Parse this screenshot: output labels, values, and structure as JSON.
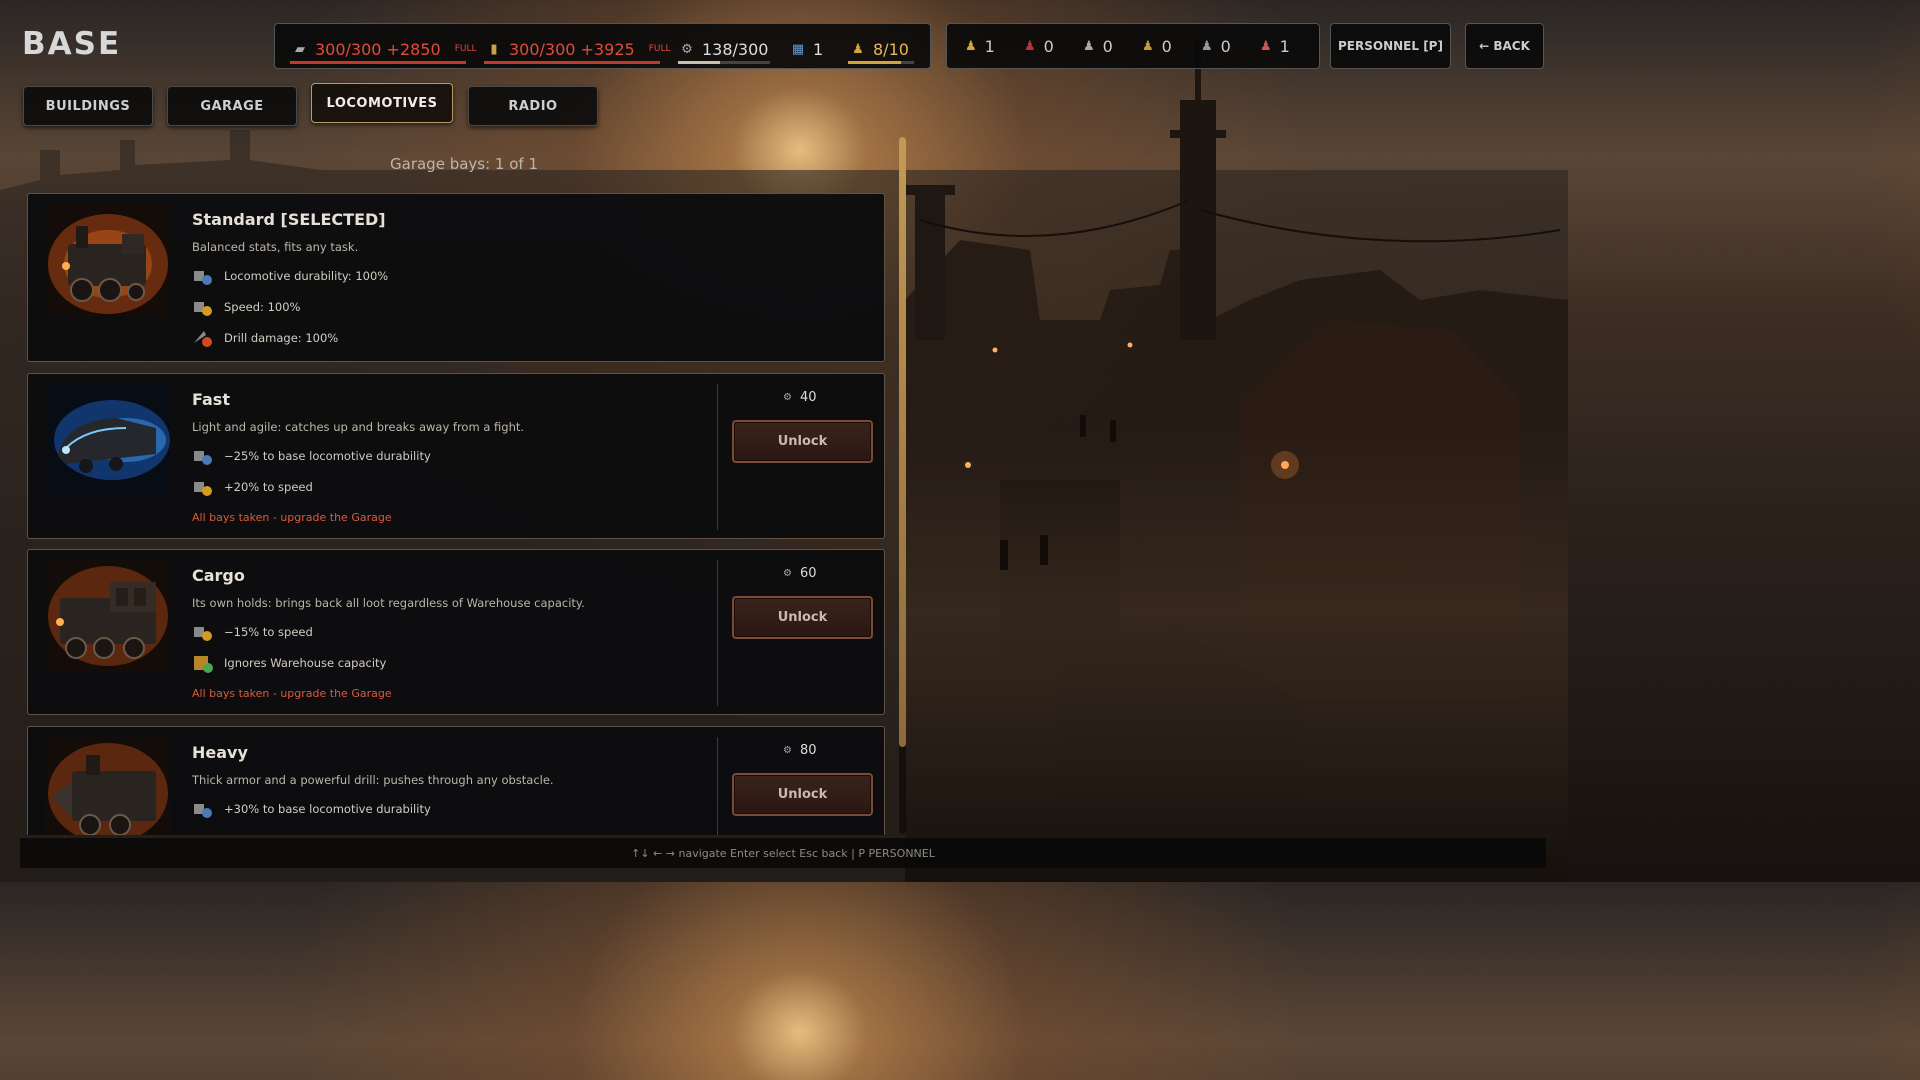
{
  "page": {
    "title": "BASE"
  },
  "resources": {
    "scrap": {
      "icon": "scrap-icon",
      "value": "300/300 +2850",
      "full": "FULL",
      "fill": 1.0
    },
    "fuel": {
      "icon": "fuel-icon",
      "value": "300/300 +3925",
      "full": "FULL",
      "fill": 1.0
    },
    "parts": {
      "icon": "parts-icon",
      "value": "138/300",
      "fill": 0.46
    },
    "blueprints": {
      "icon": "blueprint-icon",
      "value": "1"
    },
    "people": {
      "icon": "person-icon",
      "value": "8/10",
      "fill": 0.8
    }
  },
  "workers": [
    {
      "icon": "worker-icon",
      "value": "1"
    },
    {
      "icon": "soldier-icon",
      "value": "0"
    },
    {
      "icon": "engineer-icon",
      "value": "0"
    },
    {
      "icon": "miner-icon",
      "value": "0"
    },
    {
      "icon": "scout-icon",
      "value": "0"
    },
    {
      "icon": "medic-icon",
      "value": "1"
    }
  ],
  "buttons": {
    "personnel": "PERSONNEL [P]",
    "back": "← BACK"
  },
  "tabs": [
    "BUILDINGS",
    "GARAGE",
    "LOCOMOTIVES",
    "RADIO"
  ],
  "active_tab": "LOCOMOTIVES",
  "garage_bays": "Garage bays: 1 of 1",
  "locomotives": [
    {
      "name": "Standard [SELECTED]",
      "description": "Balanced stats, fits any task.",
      "stats": [
        "Locomotive durability: 100%",
        "Speed: 100%",
        "Drill damage: 100%"
      ]
    },
    {
      "name": "Fast",
      "description": "Light and agile: catches up and breaks away from a fight.",
      "stats": [
        "−25% to base locomotive durability",
        "+20% to speed"
      ],
      "warning": "All bays taken - upgrade the Garage",
      "cost": "40",
      "button": "Unlock"
    },
    {
      "name": "Cargo",
      "description": "Its own holds: brings back all loot regardless of Warehouse capacity.",
      "stats": [
        "−15% to speed",
        "Ignores Warehouse capacity"
      ],
      "warning": "All bays taken - upgrade the Garage",
      "cost": "60",
      "button": "Unlock"
    },
    {
      "name": "Heavy",
      "description": "Thick armor and a powerful drill: pushes through any obstacle.",
      "stats": [
        "+30% to base locomotive durability"
      ],
      "cost": "80",
      "button": "Unlock"
    }
  ],
  "footer": "↑↓ ← → navigate Enter select Esc back | P PERSONNEL",
  "colors": {
    "accent": "#c39a55",
    "warning": "#d95b3f",
    "resource_full": "#e24a3a"
  }
}
